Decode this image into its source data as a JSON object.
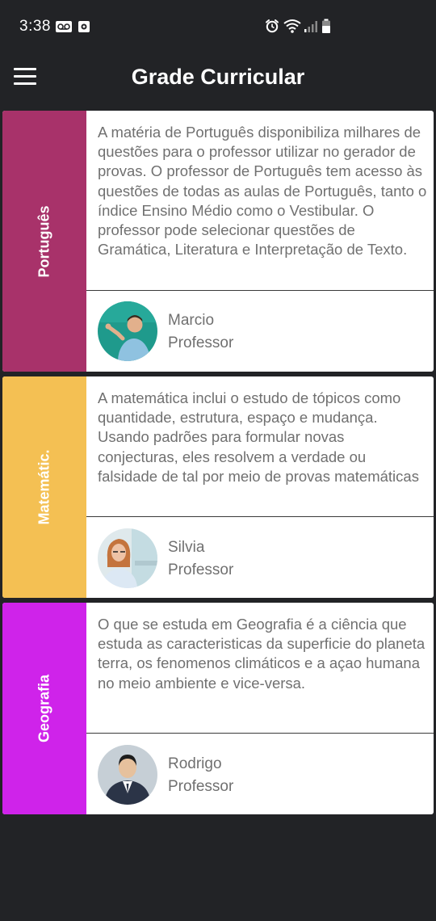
{
  "status_bar": {
    "time": "3:38"
  },
  "app_bar": {
    "title": "Grade Curricular",
    "menu_icon": "hamburger-menu-icon"
  },
  "subjects": [
    {
      "name": "Português",
      "color": "#A8326A",
      "description": "A matéria de Português disponibiliza milhares de questões para o professor utilizar no gerador de provas. O professor de Português tem acesso às questões de todas as aulas de Português, tanto o índice Ensino Médio como o Vestibular. O professor pode selecionar questões de Gramática, Literatura e Interpretação de Texto.",
      "teacher": {
        "name": "Marcio",
        "role": "Professor"
      }
    },
    {
      "name": "Matemátic.",
      "color": "#F4C053",
      "description": "A matemática inclui o estudo de tópicos como quantidade, estrutura, espaço e mudança. Usando padrões para formular novas conjecturas, eles resolvem a verdade ou falsidade de tal por meio de provas matemáticas",
      "teacher": {
        "name": "Silvia",
        "role": "Professor"
      }
    },
    {
      "name": "Geografia",
      "color": "#CF23EA",
      "description": "O que se estuda em Geografia é a ciência que estuda as caracteristicas da superficie do planeta terra, os fenomenos climáticos e a açao humana no meio ambiente e vice-versa.",
      "teacher": {
        "name": "Rodrigo",
        "role": "Professor"
      }
    }
  ]
}
